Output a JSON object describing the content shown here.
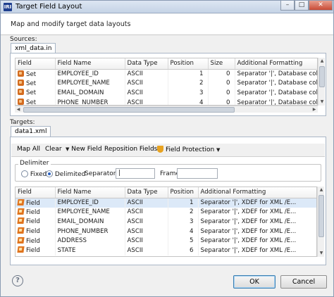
{
  "window": {
    "title": "Target Field Layout",
    "app_icon_text": "IRI",
    "buttons": {
      "minimize": "–",
      "maximize": "□",
      "close": "✕"
    }
  },
  "header": {
    "message": "Map and modify target data layouts"
  },
  "sources": {
    "label": "Sources:",
    "tab": "xml_data.in",
    "columns": [
      "Field",
      "Field Name",
      "Data Type",
      "Position",
      "Size",
      "Additional Formatting"
    ],
    "rows": [
      [
        "Set",
        "EMPLOYEE_ID",
        "ASCII",
        "1",
        "0",
        "Separator '|', Database colum..."
      ],
      [
        "Set",
        "EMPLOYEE_NAME",
        "ASCII",
        "2",
        "0",
        "Separator '|', Database colum..."
      ],
      [
        "Set",
        "EMAIL_DOMAIN",
        "ASCII",
        "3",
        "0",
        "Separator '|', Database colum..."
      ],
      [
        "Set",
        "PHONE_NUMBER",
        "ASCII",
        "4",
        "0",
        "Separator '|', Database colum..."
      ]
    ]
  },
  "targets": {
    "label": "Targets:",
    "tab": "data1.xml",
    "toolbar": {
      "map_all": "Map All",
      "clear": "Clear",
      "new_field": "New Field",
      "reposition_fields": "Reposition Fields",
      "field_protection": "Field Protection"
    },
    "delimiter": {
      "legend": "Delimiter",
      "fixed": "Fixed",
      "delimited": "Delimited",
      "selected": "Delimited",
      "separator_label": "Separator",
      "separator_value": "|",
      "frame_label": "Frame",
      "frame_value": ""
    },
    "columns": [
      "Field",
      "Field Name",
      "Data Type",
      "Position",
      "Additional Formatting"
    ],
    "selected_row": 0,
    "rows": [
      [
        "Field",
        "EMPLOYEE_ID",
        "ASCII",
        "1",
        "Separator '|', XDEF for XML /E..."
      ],
      [
        "Field",
        "EMPLOYEE_NAME",
        "ASCII",
        "2",
        "Separator '|', XDEF for XML /E..."
      ],
      [
        "Field",
        "EMAIL_DOMAIN",
        "ASCII",
        "3",
        "Separator '|', XDEF for XML /E..."
      ],
      [
        "Field",
        "PHONE_NUMBER",
        "ASCII",
        "4",
        "Separator '|', XDEF for XML /E..."
      ],
      [
        "Field",
        "ADDRESS",
        "ASCII",
        "5",
        "Separator '|', XDEF for XML /E..."
      ],
      [
        "Field",
        "STATE",
        "ASCII",
        "6",
        "Separator '|', XDEF for XML /E..."
      ]
    ]
  },
  "footer": {
    "help": "?",
    "ok": "OK",
    "cancel": "Cancel"
  }
}
